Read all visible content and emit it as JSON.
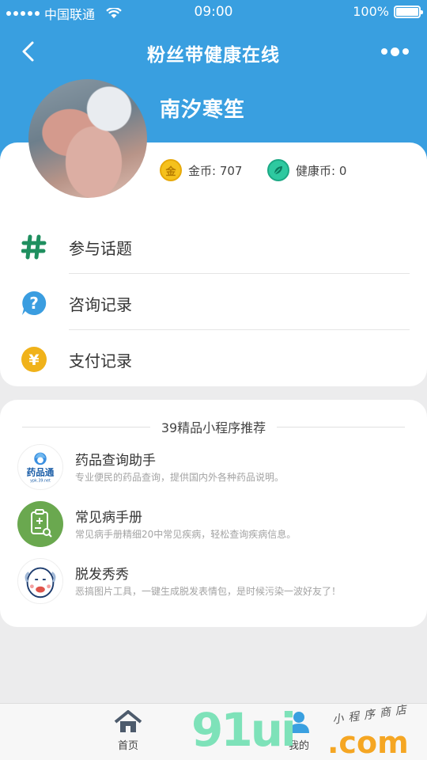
{
  "status_bar": {
    "carrier": "中国联通",
    "time": "09:00",
    "battery": "100%",
    "battery_level": 1.0
  },
  "nav": {
    "title": "粉丝带健康在线",
    "back_icon": "chevron-left-icon",
    "more_icon": "more-dots-icon"
  },
  "profile": {
    "username": "南汐寒笙",
    "gold_coin_glyph": "金",
    "gold_coin_label": "金币: 707",
    "health_coin_label": "健康币: 0"
  },
  "menu": {
    "items": [
      {
        "icon": "hash-icon",
        "label": "参与话题"
      },
      {
        "icon": "question-icon",
        "label": "咨询记录"
      },
      {
        "icon": "yen-icon",
        "label": "支付记录"
      }
    ]
  },
  "recommend": {
    "title": "39精品小程序推荐",
    "apps": [
      {
        "icon": "drug-app-icon",
        "logo_text": "药品通",
        "logo_sub": "ypk.39.net",
        "name": "药品查询助手",
        "desc": "专业便民的药品查询，提供国内外各种药品说明。"
      },
      {
        "icon": "clipboard-icon",
        "name": "常见病手册",
        "desc": "常见病手册精细20中常见疾病，轻松查询疾病信息。"
      },
      {
        "icon": "bald-face-icon",
        "name": "脱发秀秀",
        "desc": "恶搞图片工具，一键生成脱发表情包，是时候污染一波好友了！"
      }
    ]
  },
  "tab_bar": {
    "home_label": "首页",
    "mine_label": "我的"
  },
  "watermark": {
    "main": "91ui",
    "domain": ".com",
    "script": "小程序商店"
  },
  "colors": {
    "brand_blue": "#399fe0",
    "hash_green": "#1f8f5f",
    "question_blue": "#3a9de0",
    "yen_gold": "#f0b21a"
  }
}
